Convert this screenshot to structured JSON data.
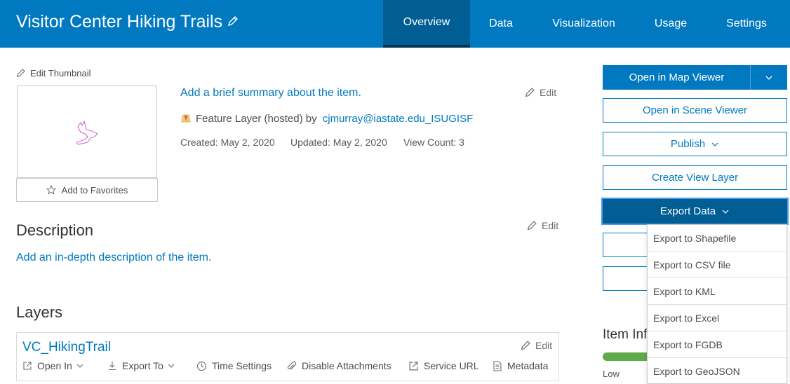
{
  "header": {
    "title": "Visitor Center Hiking Trails",
    "tabs": [
      {
        "label": "Overview",
        "active": true
      },
      {
        "label": "Data"
      },
      {
        "label": "Visualization"
      },
      {
        "label": "Usage"
      },
      {
        "label": "Settings"
      }
    ]
  },
  "thumbnail": {
    "edit_label": "Edit Thumbnail",
    "favorites_label": "Add to Favorites"
  },
  "summary": {
    "placeholder": "Add a brief summary about the item.",
    "edit_label": "Edit",
    "item_type": "Feature Layer (hosted) by",
    "owner": "cjmurray@iastate.edu_ISUGISF",
    "created": "Created: May 2, 2020",
    "updated": "Updated: May 2, 2020",
    "view_count": "View Count: 3"
  },
  "description": {
    "heading": "Description",
    "edit_label": "Edit",
    "placeholder": "Add an in-depth description of the item."
  },
  "layers": {
    "heading": "Layers",
    "layer_name": "VC_HikingTrail",
    "edit_label": "Edit",
    "tools": {
      "open_in": "Open In",
      "export_to": "Export To",
      "time_settings": "Time Settings",
      "disable_attachments": "Disable Attachments",
      "service_url": "Service URL",
      "metadata": "Metadata"
    }
  },
  "actions": {
    "open_map_viewer": "Open in Map Viewer",
    "open_scene_viewer": "Open in Scene Viewer",
    "publish": "Publish",
    "create_view_layer": "Create View Layer",
    "export_data": "Export Data"
  },
  "export_menu": {
    "items": [
      "Export to Shapefile",
      "Export to CSV file",
      "Export to KML",
      "Export to Excel",
      "Export to FGDB",
      "Export to GeoJSON"
    ]
  },
  "item_info": {
    "heading_partial": "Item Inf",
    "level_label": "Low"
  },
  "colors": {
    "brand": "#0079c1",
    "brand_dark": "#005e95",
    "progress": "#5fa94a"
  }
}
